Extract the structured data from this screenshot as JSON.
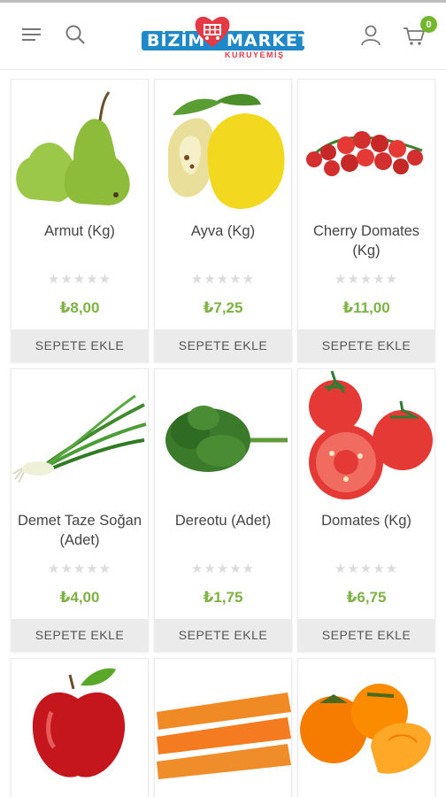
{
  "header": {
    "brand_left": "BİZİM",
    "brand_right": "MARKET",
    "brand_sub": "KURUYEMİŞ",
    "cart_count": "0",
    "icons": [
      "menu-icon",
      "search-icon",
      "user-icon",
      "cart-icon"
    ],
    "brand_colors": {
      "blue": "#1e88c9",
      "red": "#e53945",
      "green": "#74b72e"
    }
  },
  "products": [
    {
      "name": "Armut (Kg)",
      "price": "₺8,00",
      "button": "SEPETE EKLE",
      "image": "pear"
    },
    {
      "name": "Ayva (Kg)",
      "price": "₺7,25",
      "button": "SEPETE EKLE",
      "image": "quince"
    },
    {
      "name": "Cherry Domates (Kg)",
      "price": "₺11,00",
      "button": "SEPETE EKLE",
      "image": "cherry-tomatoes"
    },
    {
      "name": "Demet Taze Soğan (Adet)",
      "price": "₺4,00",
      "button": "SEPETE EKLE",
      "image": "green-onion"
    },
    {
      "name": "Dereotu (Adet)",
      "price": "₺1,75",
      "button": "SEPETE EKLE",
      "image": "dill"
    },
    {
      "name": "Domates (Kg)",
      "price": "₺6,75",
      "button": "SEPETE EKLE",
      "image": "tomatoes"
    },
    {
      "name": "",
      "price": "",
      "button": "",
      "image": "apple"
    },
    {
      "name": "",
      "price": "",
      "button": "",
      "image": "carrots"
    },
    {
      "name": "",
      "price": "",
      "button": "",
      "image": "persimmon"
    }
  ],
  "rating": {
    "stars": "★★★★★",
    "value": 0
  }
}
